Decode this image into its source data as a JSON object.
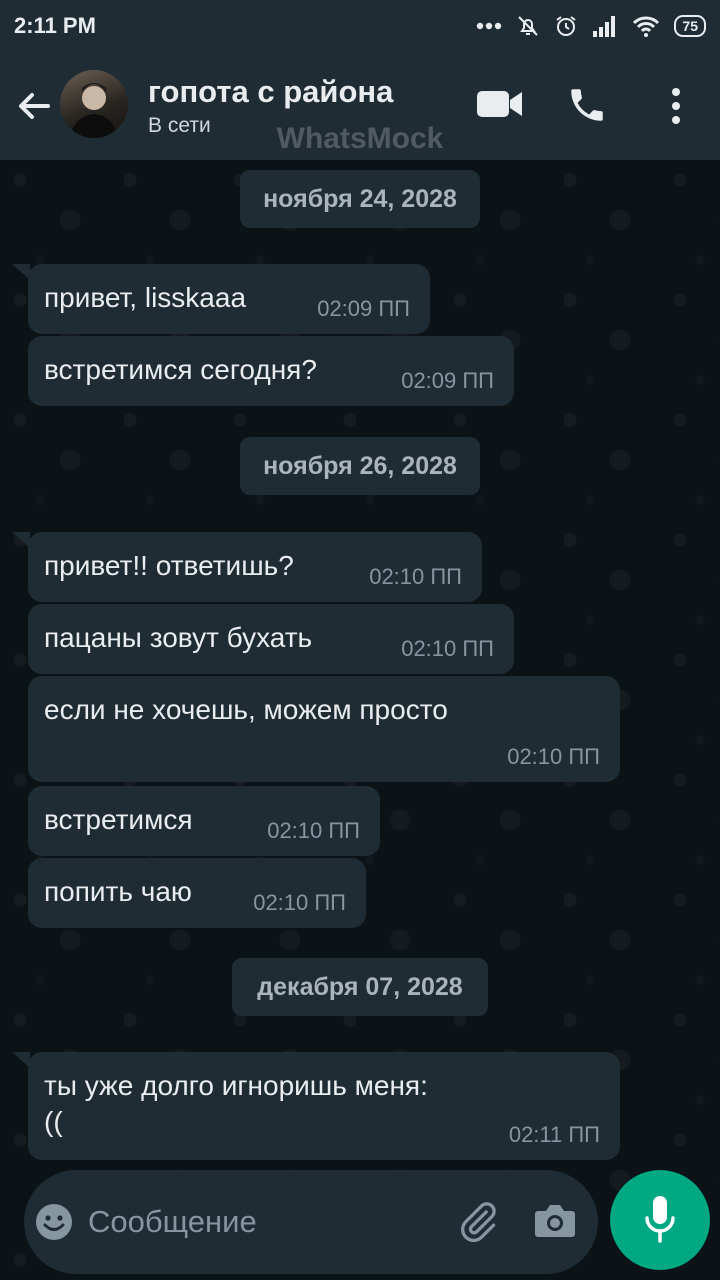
{
  "status_bar": {
    "time": "2:11 PM",
    "battery": "75"
  },
  "header": {
    "contact_name": "гопота с района",
    "contact_status": "В сети",
    "watermark": "WhatsMock"
  },
  "chat": {
    "dates": [
      "ноября 24, 2028",
      "ноября 26, 2028",
      "декабря 07, 2028"
    ],
    "messages": [
      {
        "text": "привет, lisskaaa",
        "time": "02:09 ПП"
      },
      {
        "text": "встретимся сегодня?",
        "time": "02:09 ПП"
      },
      {
        "text": "привет!! ответишь?",
        "time": "02:10 ПП"
      },
      {
        "text": "пацаны зовут бухать",
        "time": "02:10 ПП"
      },
      {
        "text": "если не хочешь, можем просто",
        "time": "02:10 ПП"
      },
      {
        "text": "встретимся",
        "time": "02:10 ПП"
      },
      {
        "text": "попить чаю",
        "time": "02:10 ПП"
      },
      {
        "line1": "ты уже долго игноришь меня:",
        "line2": "((",
        "time": "02:11 ПП"
      }
    ]
  },
  "composer": {
    "placeholder": "Сообщение"
  },
  "colors": {
    "accent": "#00a884",
    "bubble": "#202c33",
    "header": "#1f2c34",
    "background": "#0c1317"
  }
}
